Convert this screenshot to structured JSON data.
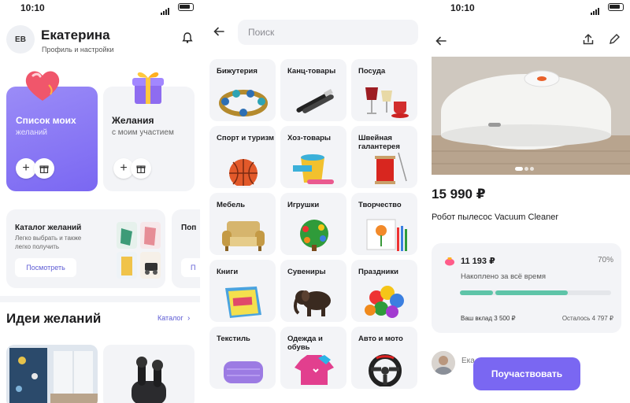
{
  "status_bar": {
    "time1": "10:10",
    "time3": "10:10"
  },
  "profile": {
    "avatar_initials": "ЕВ",
    "name": "Екатерина",
    "subtitle": "Профиль и настройки"
  },
  "cards": {
    "my_list": {
      "title": "Список моих",
      "subtitle": "желаний"
    },
    "wishes": {
      "title": "Желания",
      "subtitle": "с моим участием"
    }
  },
  "catalog_card": {
    "title": "Каталог желаний",
    "subtitle": "Легко выбрать и также легко получить",
    "button": "Посмотреть"
  },
  "catalog_card2": {
    "title": "Поп",
    "button": "П"
  },
  "ideas": {
    "title": "Идеи желаний",
    "link": "Каталог"
  },
  "search": {
    "placeholder": "Поиск"
  },
  "categories": [
    "Бижутерия",
    "Канц-товары",
    "Посуда",
    "Спорт и туризм",
    "Хоз-товары",
    "Швейная галантерея",
    "Мебель",
    "Игрушки",
    "Творчество",
    "Книги",
    "Сувениры",
    "Праздники",
    "Текстиль",
    "Одежда и обувь",
    "Авто и мото"
  ],
  "product": {
    "price": "15 990 ₽",
    "name": "Робот пылесос Vacuum Cleaner",
    "collected_amount": "11 193 ₽",
    "collected_percent": "70%",
    "collected_label": "Накоплено за всё время",
    "my_contribution": "Ваш вклад 3 500 ₽",
    "remaining": "Осталось 4 797 ₽",
    "progress": {
      "my_share": 0.22,
      "others_share": 0.48
    },
    "guest_name": "Ека",
    "cta": "Поучаствовать"
  },
  "colors": {
    "accent": "#7a67f2",
    "progress": "#5ec4a8",
    "card_bg": "#f3f4f7"
  }
}
